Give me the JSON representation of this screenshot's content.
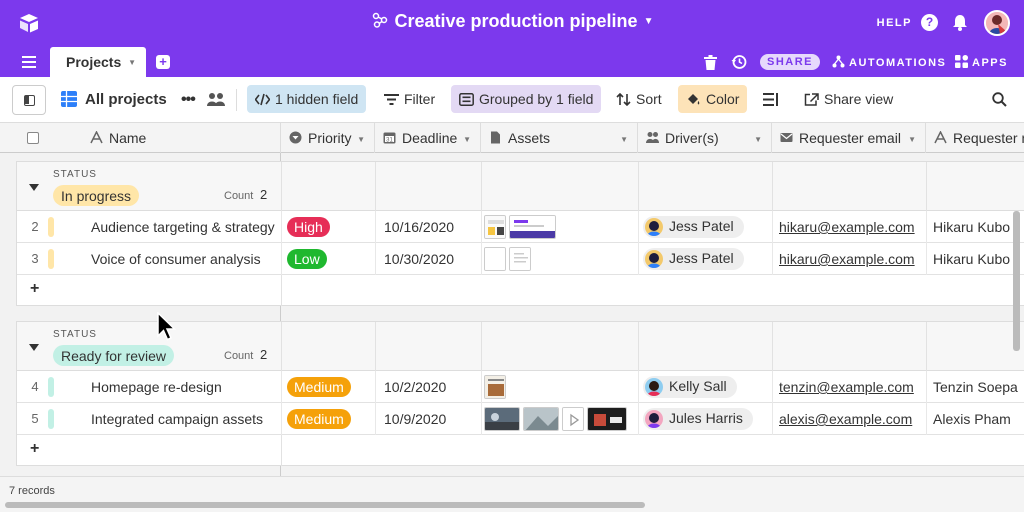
{
  "topbar": {
    "title": "Creative production pipeline",
    "help": "HELP",
    "help_glyph": "?"
  },
  "tabbar": {
    "tab": "Projects",
    "add_glyph": "+",
    "share": "SHARE",
    "automations": "AUTOMATIONS",
    "apps": "APPS"
  },
  "toolbar": {
    "view_name": "All projects",
    "more_glyph": "•••",
    "hidden_field": "1 hidden field",
    "filter": "Filter",
    "grouped": "Grouped by 1 field",
    "sort": "Sort",
    "color": "Color",
    "share_view": "Share view"
  },
  "columns": [
    "Name",
    "Priority",
    "Deadline",
    "Assets",
    "Driver(s)",
    "Requester email",
    "Requester n"
  ],
  "groups": [
    {
      "label": "STATUS",
      "value": "In progress",
      "count_label": "Count",
      "count": "2",
      "pill_color": "#ffe6a8",
      "bar_color": "#ffe6a8",
      "rows": [
        {
          "num": "2",
          "name": "Audience targeting & strategy",
          "priority": "High",
          "priority_color": "#e62e57",
          "deadline": "10/16/2020",
          "driver": "Jess Patel",
          "email": "hikaru@example.com",
          "requester": "Hikaru Kubo"
        },
        {
          "num": "3",
          "name": "Voice of consumer analysis",
          "priority": "Low",
          "priority_color": "#1fb82f",
          "deadline": "10/30/2020",
          "driver": "Jess Patel",
          "email": "hikaru@example.com",
          "requester": "Hikaru Kubo"
        }
      ]
    },
    {
      "label": "STATUS",
      "value": "Ready for review",
      "count_label": "Count",
      "count": "2",
      "pill_color": "#c2f0e5",
      "bar_color": "#c2f0e5",
      "rows": [
        {
          "num": "4",
          "name": "Homepage re-design",
          "priority": "Medium",
          "priority_color": "#f5a10a",
          "deadline": "10/2/2020",
          "driver": "Kelly Sall",
          "email": "tenzin@example.com",
          "requester": "Tenzin Soepa"
        },
        {
          "num": "5",
          "name": "Integrated campaign assets",
          "priority": "Medium",
          "priority_color": "#f5a10a",
          "deadline": "10/9/2020",
          "driver": "Jules Harris",
          "email": "alexis@example.com",
          "requester": "Alexis Pham"
        }
      ]
    }
  ],
  "add_glyph": "+",
  "footer": {
    "records": "7 records"
  },
  "colors": {
    "brand": "#7c39ed"
  }
}
